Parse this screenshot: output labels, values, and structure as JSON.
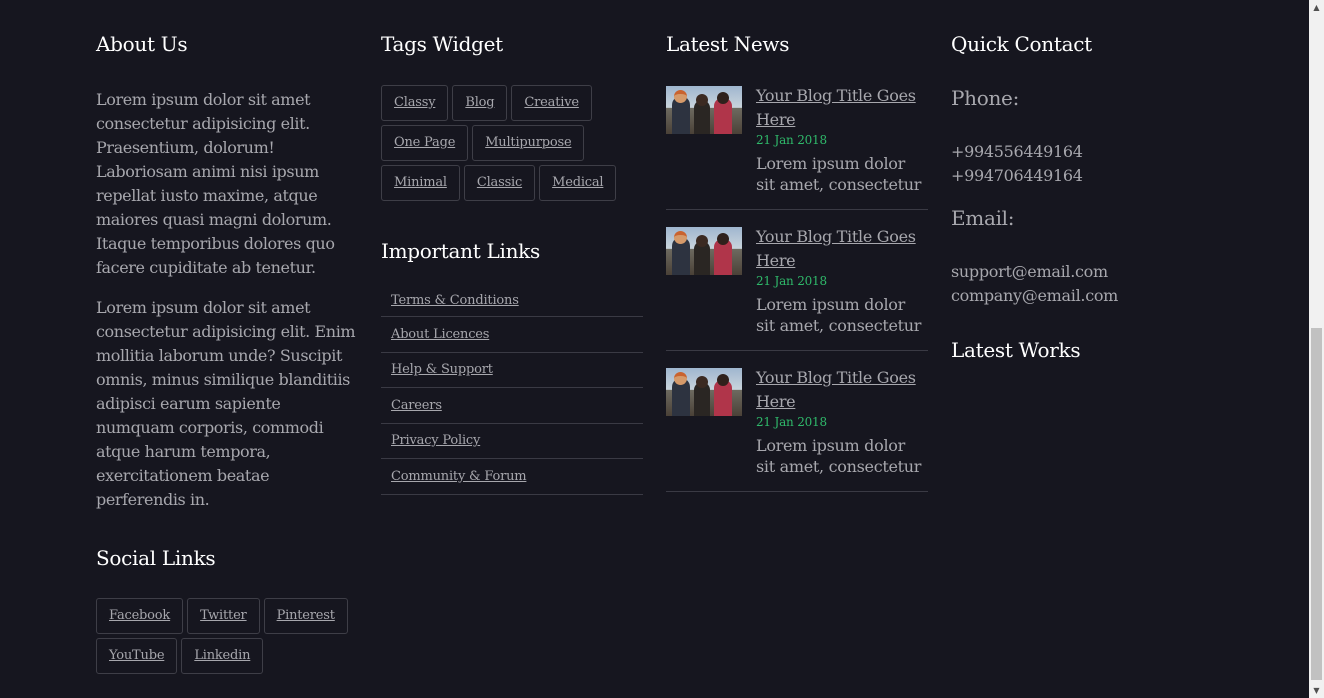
{
  "about": {
    "title": "About Us",
    "paragraph1": "Lorem ipsum dolor sit amet consectetur adipisicing elit. Praesentium, dolorum! Laboriosam animi nisi ipsum repellat iusto maxime, atque maiores quasi magni dolorum. Itaque temporibus dolores quo facere cupiditate ab tenetur.",
    "paragraph2": "Lorem ipsum dolor sit amet consectetur adipisicing elit. Enim mollitia laborum unde? Suscipit omnis, minus similique blanditiis adipisci earum sapiente numquam corporis, commodi atque harum tempora, exercitationem beatae perferendis in."
  },
  "social": {
    "title": "Social Links",
    "links": [
      "Facebook",
      "Twitter",
      "Pinterest",
      "YouTube",
      "Linkedin"
    ]
  },
  "tags": {
    "title": "Tags Widget",
    "items": [
      "Classy",
      "Blog",
      "Creative",
      "One Page",
      "Multipurpose",
      "Minimal",
      "Classic",
      "Medical"
    ]
  },
  "important_links": {
    "title": "Important Links",
    "items": [
      "Terms & Conditions",
      "About Licences",
      "Help & Support",
      "Careers",
      "Privacy Policy",
      "Community & Forum"
    ]
  },
  "news": {
    "title": "Latest News",
    "items": [
      {
        "title": "Your Blog Title Goes Here",
        "date": "21 Jan 2018",
        "excerpt": "Lorem ipsum dolor sit amet, consectetur"
      },
      {
        "title": "Your Blog Title Goes Here",
        "date": "21 Jan 2018",
        "excerpt": "Lorem ipsum dolor sit amet, consectetur"
      },
      {
        "title": "Your Blog Title Goes Here",
        "date": "21 Jan 2018",
        "excerpt": "Lorem ipsum dolor sit amet, consectetur"
      }
    ]
  },
  "contact": {
    "title": "Quick Contact",
    "phone_label": "Phone:",
    "phones": [
      "+994556449164",
      "+994706449164"
    ],
    "email_label": "Email:",
    "emails": [
      "support@email.com",
      "company@email.com"
    ]
  },
  "works": {
    "title": "Latest Works"
  },
  "colors": {
    "background": "#16161f",
    "heading": "#ffffff",
    "text": "#a7a7ad",
    "date_accent": "#2fb86a",
    "border": "#3e3e47"
  }
}
